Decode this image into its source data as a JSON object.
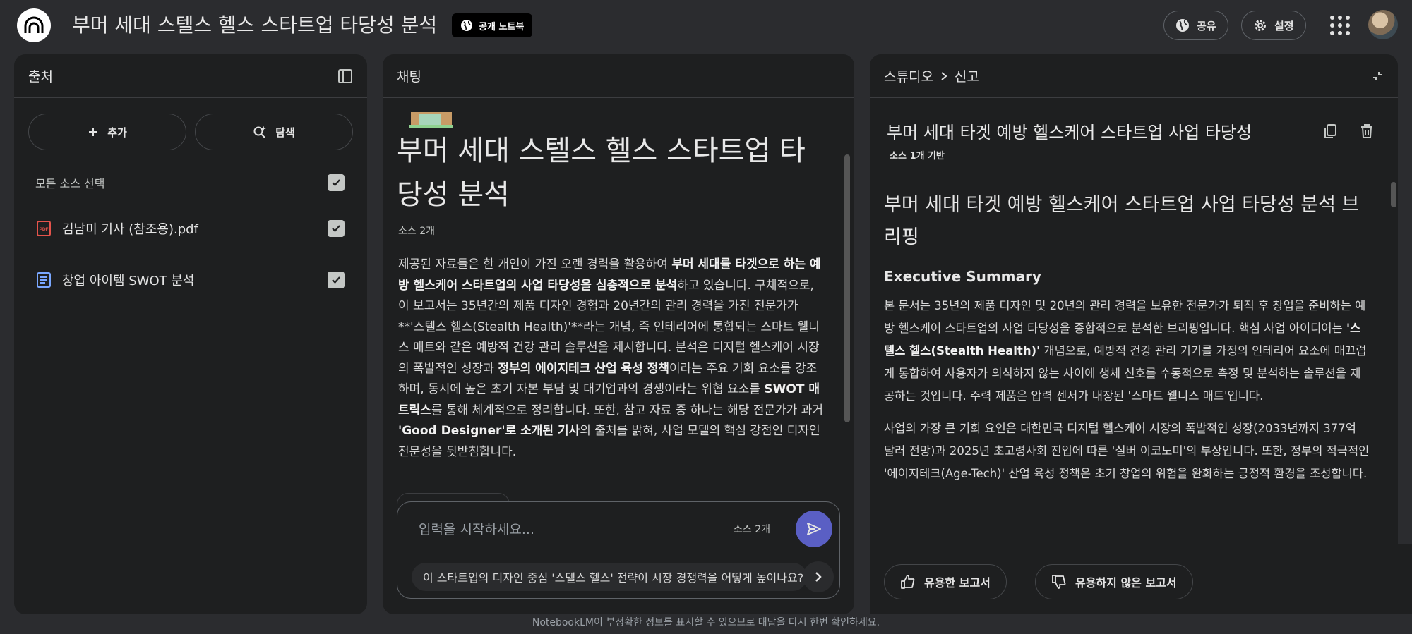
{
  "header": {
    "title": "부머 세대 스텔스 헬스 스타트업 타당성 분석",
    "public_badge": "공개 노트북",
    "share_label": "공유",
    "settings_label": "설정"
  },
  "sources": {
    "title": "출처",
    "add_label": "추가",
    "discover_label": "탐색",
    "select_all_label": "모든 소스 선택",
    "items": [
      {
        "label": "김남미 기사 (참조용).pdf",
        "icon": "pdf-icon",
        "checked": true
      },
      {
        "label": "창업 아이템 SWOT 분석",
        "icon": "document-icon",
        "checked": true
      }
    ]
  },
  "chat": {
    "title": "채팅",
    "doc_title": "부머 세대 스텔스 헬스 스타트업 타당성 분석",
    "doc_source_count": "소스 2개",
    "summary_segments": [
      {
        "t": "제공된 자료들은 한 개인이 가진 오랜 경력을 활용하여 ",
        "b": false
      },
      {
        "t": "부머 세대를 타겟으로 하는 예방 헬스케어 스타트업의 사업 타당성을 심층적으로 분석",
        "b": true
      },
      {
        "t": "하고 있습니다. 구체적으로, 이 보고서는 35년간의 제품 디자인 경험과 20년간의 관리 경력을 가진 전문가가 **'스텔스 헬스(Stealth Health)'**라는 개념, 즉 인테리어에 통합되는 스마트 웰니스 매트와 같은 예방적 건강 관리 솔루션을 제시합니다. 분석은 디지털 헬스케어 시장의 폭발적인 성장과 ",
        "b": false
      },
      {
        "t": "정부의 에이지테크 산업 육성 정책",
        "b": true
      },
      {
        "t": "이라는 주요 기회 요소를 강조하며, 동시에 높은 초기 자본 부담 및 대기업과의 경쟁이라는 위협 요소를 ",
        "b": false
      },
      {
        "t": "SWOT 매트릭스",
        "b": true
      },
      {
        "t": "를 통해 체계적으로 정리합니다. 또한, 참고 자료 중 하나는 해당 전문가가 과거 ",
        "b": false
      },
      {
        "t": "'Good Designer'로 소개된 기사",
        "b": true
      },
      {
        "t": "의 출처를 밝혀, 사업 모델의 핵심 강점인 디자인 전문성을 뒷받침합니다.",
        "b": false
      }
    ],
    "input_placeholder": "입력을 시작하세요...",
    "input_source_count": "소스 2개",
    "suggestion": "이 스타트업의 디자인 중심 '스텔스 헬스' 전략이 시장 경쟁력을 어떻게 높이나요?"
  },
  "studio": {
    "breadcrumb_root": "스튜디오",
    "breadcrumb_current": "신고",
    "report_title": "부머 세대 타겟 예방 헬스케어 스타트업 사업 타당성",
    "report_badge": "소스 1개 기반",
    "heading": "부머 세대 타겟 예방 헬스케어 스타트업 사업 타당성 분석 브리핑",
    "section_title": "Executive Summary",
    "para1_segments": [
      {
        "t": "본 문서는 35년의 제품 디자인 및 20년의 관리 경력을 보유한 전문가가 퇴직 후 창업을 준비하는 예방 헬스케어 스타트업의 사업 타당성을 종합적으로 분석한 브리핑입니다. 핵심 사업 아이디어는 ",
        "b": false
      },
      {
        "t": "'스텔스 헬스(Stealth Health)'",
        "b": true
      },
      {
        "t": " 개념으로, 예방적 건강 관리 기기를 가정의 인테리어 요소에 매끄럽게 통합하여 사용자가 의식하지 않는 사이에 생체 신호를 수동적으로 측정 및 분석하는 솔루션을 제공하는 것입니다. 주력 제품은 압력 센서가 내장된 '스마트 웰니스 매트'입니다.",
        "b": false
      }
    ],
    "para2": "사업의 가장 큰 기회 요인은 대한민국 디지털 헬스케어 시장의 폭발적인 성장(2033년까지 377억 달러 전망)과 2025년 초고령사회 진입에 따른 '실버 이코노미'의 부상입니다. 또한, 정부의 적극적인 '에이지테크(Age-Tech)' 산업 육성 정책은 초기 창업의 위험을 완화하는 긍정적 환경을 조성합니다.",
    "helpful_label": "유용한 보고서",
    "not_helpful_label": "유용하지 않은 보고서"
  },
  "footer_note": "NotebookLM이 부정확한 정보를 표시할 수 있으므로 대답을 다시 한번 확인하세요.",
  "colors": {
    "background": "#2b2c2f",
    "panel": "#1e1f20",
    "send_button": "#5a5fc4"
  }
}
